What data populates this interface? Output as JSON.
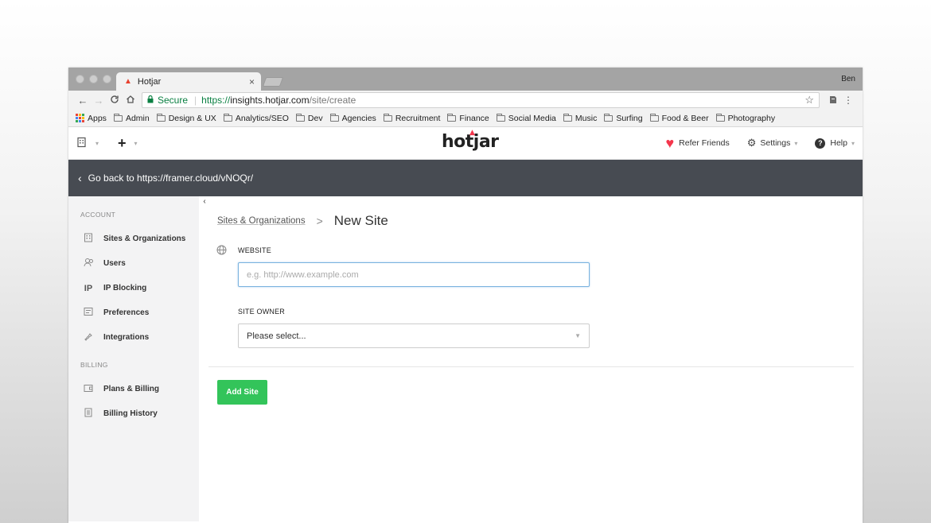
{
  "browser": {
    "tab_title": "Hotjar",
    "tab_close": "×",
    "profile_name": "Ben",
    "back": "←",
    "forward": "→",
    "reload": "C",
    "home": "⌂",
    "secure_label": "Secure",
    "url_scheme": "https://",
    "url_host": "insights.hotjar.com",
    "url_path": "/site/create",
    "star": "☆",
    "menu": "⋮"
  },
  "bookmarks": [
    {
      "label": "Apps",
      "type": "apps"
    },
    {
      "label": "Admin"
    },
    {
      "label": "Design & UX"
    },
    {
      "label": "Analytics/SEO"
    },
    {
      "label": "Dev"
    },
    {
      "label": "Agencies"
    },
    {
      "label": "Recruitment"
    },
    {
      "label": "Finance"
    },
    {
      "label": "Social Media"
    },
    {
      "label": "Music"
    },
    {
      "label": "Surfing"
    },
    {
      "label": "Food & Beer"
    },
    {
      "label": "Photography"
    }
  ],
  "header": {
    "logo": "hotjar",
    "refer_friends": "Refer Friends",
    "settings": "Settings",
    "help": "Help",
    "plus": "+"
  },
  "backbar": {
    "label": "Go back to https://framer.cloud/vNOQr/"
  },
  "sidebar": {
    "account_heading": "ACCOUNT",
    "billing_heading": "BILLING",
    "collapse": "‹",
    "account_items": [
      {
        "label": "Sites & Organizations",
        "icon": "building-icon"
      },
      {
        "label": "Users",
        "icon": "users-icon"
      },
      {
        "label": "IP Blocking",
        "icon": "ip-icon"
      },
      {
        "label": "Preferences",
        "icon": "preferences-icon"
      },
      {
        "label": "Integrations",
        "icon": "integrations-icon"
      }
    ],
    "billing_items": [
      {
        "label": "Plans & Billing",
        "icon": "wallet-icon"
      },
      {
        "label": "Billing History",
        "icon": "receipt-icon"
      }
    ]
  },
  "main": {
    "breadcrumb_link": "Sites & Organizations",
    "breadcrumb_sep": ">",
    "breadcrumb_current": "New Site",
    "website_label": "WEBSITE",
    "website_placeholder": "e.g. http://www.example.com",
    "site_owner_label": "SITE OWNER",
    "site_owner_value": "Please select...",
    "add_site_button": "Add Site"
  },
  "colors": {
    "backbar_bg": "#474b52",
    "add_button": "#33c45a",
    "brand_red": "#f4364c",
    "secure_green": "#0b8043"
  }
}
